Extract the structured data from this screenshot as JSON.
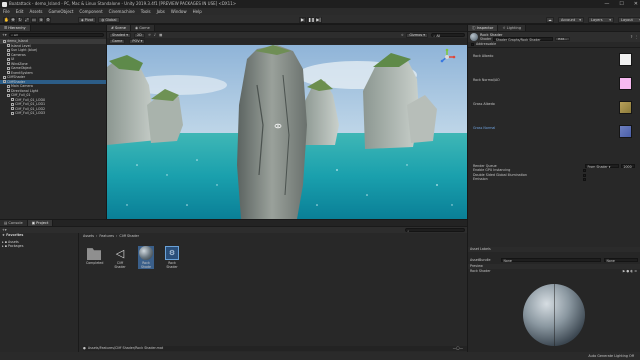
{
  "window": {
    "title": "Boatattack - demo_Island - PC, Mac & Linux Standalone - Unity 2019.3.4f1 [PREVIEW PACKAGES IN USE] <DX11>",
    "controls": [
      "—",
      "☐",
      "✕"
    ]
  },
  "menu": [
    "File",
    "Edit",
    "Assets",
    "GameObject",
    "Component",
    "Cinemachine",
    "Tools",
    "Jobs",
    "Window",
    "Help"
  ],
  "toolbar": {
    "pivot": "Pivot",
    "global": "Global",
    "account": "Account",
    "layers": "Layers",
    "layout": "Layout"
  },
  "hierarchy": {
    "tab": "Hierarchy",
    "search_placeholder": "All",
    "rows": [
      {
        "label": "demo_Island",
        "indent": 0
      },
      {
        "label": "Island Level",
        "indent": 1
      },
      {
        "label": "Sun Light (blue)",
        "indent": 1
      },
      {
        "label": "Cameras",
        "indent": 1
      },
      {
        "label": "UI",
        "indent": 1
      },
      {
        "label": "WindZone",
        "indent": 1
      },
      {
        "label": "GameObject",
        "indent": 1
      },
      {
        "label": "EventSystem",
        "indent": 1
      },
      {
        "label": "CliffShader",
        "indent": 0
      },
      {
        "label": "CliffShader",
        "indent": 0
      },
      {
        "label": "Main Camera",
        "indent": 1
      },
      {
        "label": "Directional Light",
        "indent": 1
      },
      {
        "label": "Cliff_Full_01",
        "indent": 1
      },
      {
        "label": "Cliff_Full_01_LOD0",
        "indent": 2
      },
      {
        "label": "Cliff_Full_01_LOD1",
        "indent": 2
      },
      {
        "label": "Cliff_Full_01_LOD2",
        "indent": 2
      },
      {
        "label": "Cliff_Full_01_LOD3",
        "indent": 2
      }
    ]
  },
  "scene": {
    "tabs": [
      "Scene",
      "Game"
    ],
    "draw_mode": "Shaded",
    "twod": "2D",
    "gizmos": "Gizmos",
    "search_placeholder": "All",
    "view_tab": "Game",
    "pov": "POV"
  },
  "inspector": {
    "tabs": [
      "Inspector",
      "Lighting"
    ],
    "material_name": "Rock Shader",
    "shader_label": "Shader",
    "shader_value": "Shader Graphs/Rock Shader",
    "edit": "Edit...",
    "addressable": "Addressable",
    "properties": [
      "Rock Albedo",
      "Rock Normal/AO",
      "Grass Albedo",
      "Grass Normal"
    ],
    "render_queue_label": "Render Queue",
    "render_queue_mode": "From Shader",
    "render_queue_value": "2000",
    "toggles": [
      "Enable GPU Instancing",
      "Double Sided Global Illumination",
      "Emission"
    ],
    "asset_labels": "Asset Labels",
    "assetbundle_label": "AssetBundle",
    "assetbundle_value": "None",
    "assetbundle_variant": "None",
    "preview_label": "Preview",
    "preview_name": "Rock Shader"
  },
  "project": {
    "tabs": [
      "Console",
      "Project"
    ],
    "favorites": "Favorites",
    "assets": "Assets",
    "packages": "Packages",
    "breadcrumb": [
      "Assets",
      "Features",
      "Cliff Shader"
    ],
    "items": [
      {
        "label": "Completed",
        "kind": "folder"
      },
      {
        "label": "Cliff Shader",
        "kind": "unity"
      },
      {
        "label": "Rock Shade",
        "kind": "sphere"
      },
      {
        "label": "Rock Shader",
        "kind": "shader"
      }
    ],
    "path": "Assets/Features/Cliff Shader/Rock Shader.mat"
  },
  "status": {
    "right": "Auto Generate Lighting Off"
  },
  "colors": {
    "accent": "#3a79bb",
    "bg": "#282828"
  }
}
